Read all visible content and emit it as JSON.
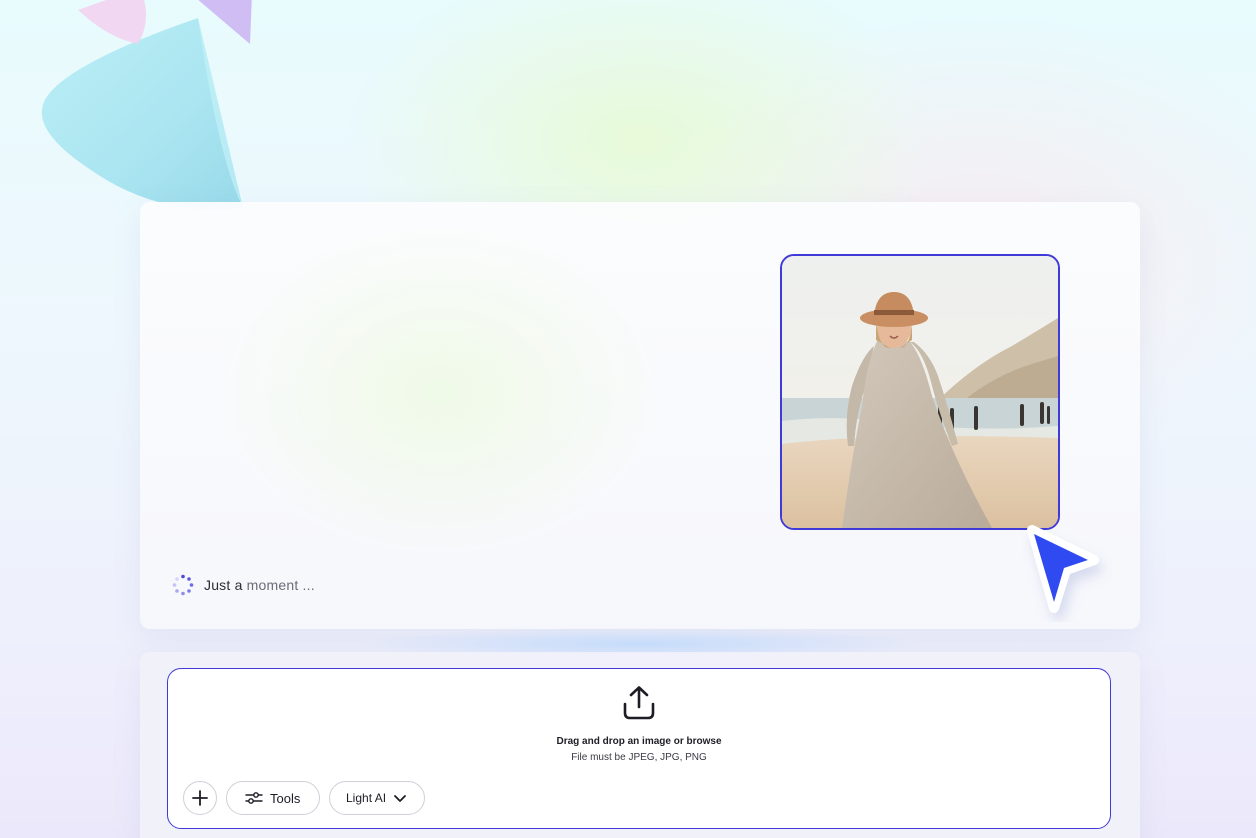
{
  "result": {
    "status_text_main": "Just a ",
    "status_text_fade": "moment ...",
    "photo_subject": "woman in linen dress and straw hat on beach"
  },
  "upload": {
    "title": "Drag and drop an image or browse",
    "subtitle": "File must be JPEG, JPG, PNG"
  },
  "toolbar": {
    "tools_label": "Tools",
    "model_label": "Light AI"
  },
  "colors": {
    "accent": "#3f3ad8",
    "cursor": "#2f4af0"
  },
  "icons": [
    "upload-icon",
    "plus-icon",
    "sliders-icon",
    "chevron-down-icon",
    "spinner-icon",
    "cursor-arrow-icon"
  ]
}
